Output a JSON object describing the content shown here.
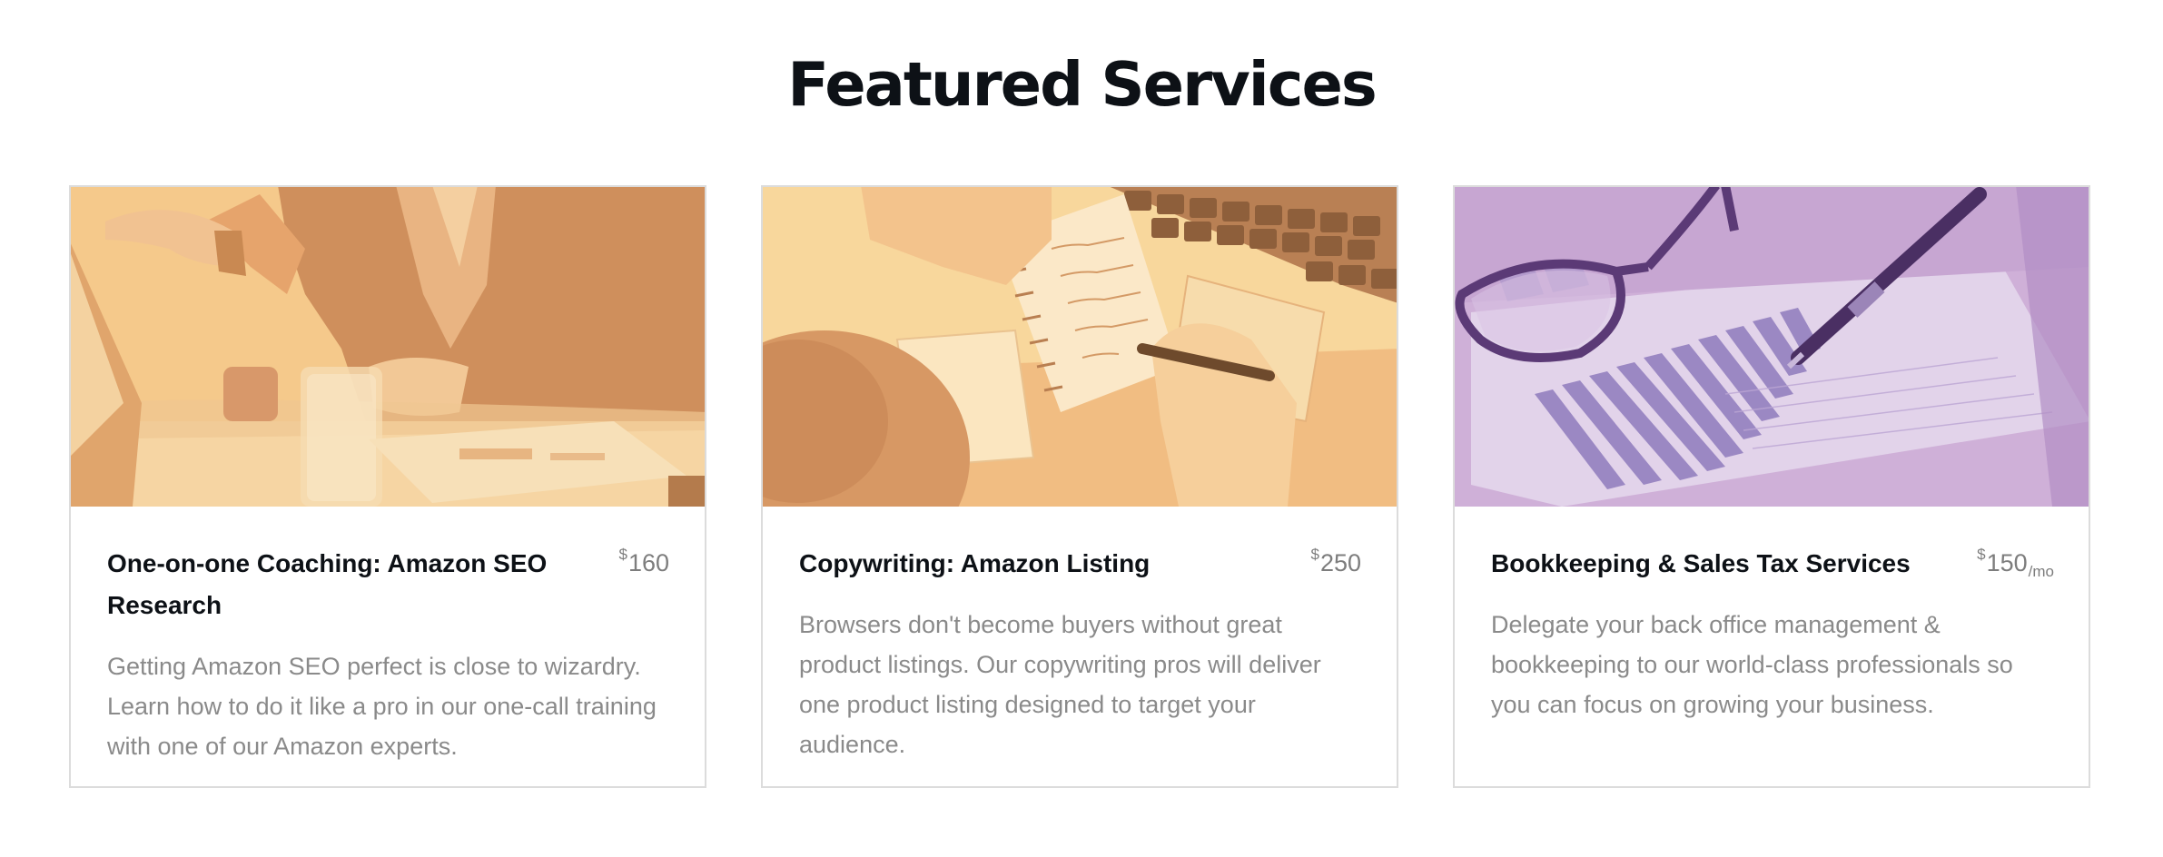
{
  "section": {
    "title": "Featured Services"
  },
  "cards": [
    {
      "title": "One-on-one Coaching: Amazon SEO Research",
      "currency": "$",
      "price": "160",
      "period": "",
      "description": "Getting Amazon SEO perfect is close to wizardry. Learn how to do it like a pro in our one-call training with one of our Amazon experts.",
      "image_icon": "business-meeting-photo",
      "tint_color": "#f3b777"
    },
    {
      "title": "Copywriting: Amazon Listing",
      "currency": "$",
      "price": "250",
      "period": "",
      "description": "Browsers don't become buyers without great product listings. Our copywriting pros will deliver one product listing designed to target your audience.",
      "image_icon": "notebook-writing-photo",
      "tint_color": "#f6c47f"
    },
    {
      "title": "Bookkeeping & Sales Tax Services",
      "currency": "$",
      "price": "150",
      "period": "/mo",
      "description": "Delegate your back office management & bookkeeping to our world-class professionals so you can focus on growing your business.",
      "image_icon": "glasses-chart-pen-photo",
      "tint_color": "#b48fc4"
    }
  ]
}
